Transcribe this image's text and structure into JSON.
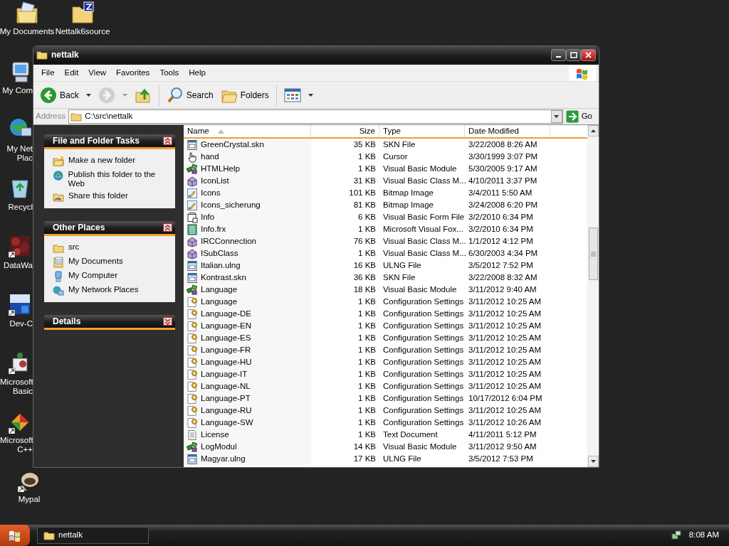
{
  "desktop_icons": [
    {
      "label": "My Documents",
      "kind": "documents"
    },
    {
      "label": "Nettalk6source",
      "kind": "zipfolder"
    },
    {
      "label": "My Com",
      "kind": "computer"
    },
    {
      "label": "My Net\nPlac",
      "kind": "network"
    },
    {
      "label": "Recycl",
      "kind": "recycle"
    },
    {
      "label": "DataWa",
      "kind": "texture"
    },
    {
      "label": "Dev-C",
      "kind": "devc"
    },
    {
      "label": "Microsoft\nBasic",
      "kind": "basic"
    },
    {
      "label": "Microsoft\nC++",
      "kind": "cpp"
    },
    {
      "label": "Mypal",
      "kind": "mypal"
    }
  ],
  "window": {
    "title": "nettalk"
  },
  "menu": [
    "File",
    "Edit",
    "View",
    "Favorites",
    "Tools",
    "Help"
  ],
  "toolbar": [
    {
      "kind": "back",
      "label": "Back",
      "disabled": false
    },
    {
      "kind": "forward",
      "disabled": true
    },
    {
      "kind": "up",
      "disabled": false
    },
    {
      "kind": "search",
      "label": "Search",
      "disabled": false
    },
    {
      "kind": "folders",
      "label": "Folders",
      "disabled": false
    },
    {
      "kind": "views",
      "disabled": false
    }
  ],
  "address": {
    "label": "Address",
    "value": "C:\\src\\nettalk",
    "go": "Go"
  },
  "task_panes": [
    {
      "title": "File and Folder Tasks",
      "expanded": true,
      "items": [
        {
          "label": "Make a new folder",
          "kind": "new_folder"
        },
        {
          "label": "Publish this folder to the Web",
          "kind": "publish"
        },
        {
          "label": "Share this folder",
          "kind": "share"
        }
      ]
    },
    {
      "title": "Other Places",
      "expanded": true,
      "items": [
        {
          "label": "src",
          "kind": "folder"
        },
        {
          "label": "My Documents",
          "kind": "documents"
        },
        {
          "label": "My Computer",
          "kind": "computer"
        },
        {
          "label": "My Network Places",
          "kind": "network"
        }
      ]
    },
    {
      "title": "Details",
      "expanded": false
    }
  ],
  "file_list": {
    "columns": [
      {
        "label": "Name",
        "sorted": true
      },
      {
        "label": "Size",
        "sorted": false
      },
      {
        "label": "Type",
        "sorted": false
      },
      {
        "label": "Date Modified",
        "sorted": false
      }
    ],
    "rows": [
      {
        "name": "GreenCrystal.skn",
        "size": "35 KB",
        "type": "SKN File",
        "date": "3/22/2008 8:26 AM",
        "kind": "window"
      },
      {
        "name": "hand",
        "size": "1 KB",
        "type": "Cursor",
        "date": "3/30/1999 3:07 PM",
        "kind": "cursor"
      },
      {
        "name": "HTMLHelp",
        "size": "1 KB",
        "type": "Visual Basic Module",
        "date": "5/30/2005 9:17 AM",
        "kind": "module"
      },
      {
        "name": "IconList",
        "size": "31 KB",
        "type": "Visual Basic Class M...",
        "date": "4/10/2011 3:37 PM",
        "kind": "class"
      },
      {
        "name": "Icons",
        "size": "101 KB",
        "type": "Bitmap Image",
        "date": "3/4/2011 5:50 AM",
        "kind": "bitmap"
      },
      {
        "name": "Icons_sicherung",
        "size": "81 KB",
        "type": "Bitmap Image",
        "date": "3/24/2008 6:20 PM",
        "kind": "bitmap"
      },
      {
        "name": "Info",
        "size": "6 KB",
        "type": "Visual Basic Form File",
        "date": "3/2/2010 6:34 PM",
        "kind": "form"
      },
      {
        "name": "Info.frx",
        "size": "1 KB",
        "type": "Microsoft Visual Fox...",
        "date": "3/2/2010 6:34 PM",
        "kind": "data"
      },
      {
        "name": "IRCConnection",
        "size": "76 KB",
        "type": "Visual Basic Class M...",
        "date": "1/1/2012 4:12 PM",
        "kind": "class"
      },
      {
        "name": "ISubClass",
        "size": "1 KB",
        "type": "Visual Basic Class M...",
        "date": "6/30/2003 4:34 PM",
        "kind": "class"
      },
      {
        "name": "Italian.ulng",
        "size": "16 KB",
        "type": "ULNG File",
        "date": "3/5/2012 7:52 PM",
        "kind": "window"
      },
      {
        "name": "Kontrast.skn",
        "size": "36 KB",
        "type": "SKN File",
        "date": "3/22/2008 8:32 AM",
        "kind": "window"
      },
      {
        "name": "Language",
        "size": "18 KB",
        "type": "Visual Basic Module",
        "date": "3/11/2012 9:40 AM",
        "kind": "module"
      },
      {
        "name": "Language",
        "size": "1 KB",
        "type": "Configuration Settings",
        "date": "3/11/2012 10:25 AM",
        "kind": "config"
      },
      {
        "name": "Language-DE",
        "size": "1 KB",
        "type": "Configuration Settings",
        "date": "3/11/2012 10:25 AM",
        "kind": "config"
      },
      {
        "name": "Language-EN",
        "size": "1 KB",
        "type": "Configuration Settings",
        "date": "3/11/2012 10:25 AM",
        "kind": "config"
      },
      {
        "name": "Language-ES",
        "size": "1 KB",
        "type": "Configuration Settings",
        "date": "3/11/2012 10:25 AM",
        "kind": "config"
      },
      {
        "name": "Language-FR",
        "size": "1 KB",
        "type": "Configuration Settings",
        "date": "3/11/2012 10:25 AM",
        "kind": "config"
      },
      {
        "name": "Language-HU",
        "size": "1 KB",
        "type": "Configuration Settings",
        "date": "3/11/2012 10:25 AM",
        "kind": "config"
      },
      {
        "name": "Language-IT",
        "size": "1 KB",
        "type": "Configuration Settings",
        "date": "3/11/2012 10:25 AM",
        "kind": "config"
      },
      {
        "name": "Language-NL",
        "size": "1 KB",
        "type": "Configuration Settings",
        "date": "3/11/2012 10:25 AM",
        "kind": "config"
      },
      {
        "name": "Language-PT",
        "size": "1 KB",
        "type": "Configuration Settings",
        "date": "10/17/2012 6:04 PM",
        "kind": "config"
      },
      {
        "name": "Language-RU",
        "size": "1 KB",
        "type": "Configuration Settings",
        "date": "3/11/2012 10:25 AM",
        "kind": "config"
      },
      {
        "name": "Language-SW",
        "size": "1 KB",
        "type": "Configuration Settings",
        "date": "3/11/2012 10:26 AM",
        "kind": "config"
      },
      {
        "name": "License",
        "size": "1 KB",
        "type": "Text Document",
        "date": "4/11/2011 5:12 PM",
        "kind": "text"
      },
      {
        "name": "LogModul",
        "size": "14 KB",
        "type": "Visual Basic Module",
        "date": "3/11/2012 9:50 AM",
        "kind": "module"
      },
      {
        "name": "Magyar.ulng",
        "size": "17 KB",
        "type": "ULNG File",
        "date": "3/5/2012 7:53 PM",
        "kind": "window"
      }
    ]
  },
  "taskbar": {
    "tasks": [
      {
        "label": "nettalk"
      }
    ],
    "clock": "8:08 AM"
  }
}
